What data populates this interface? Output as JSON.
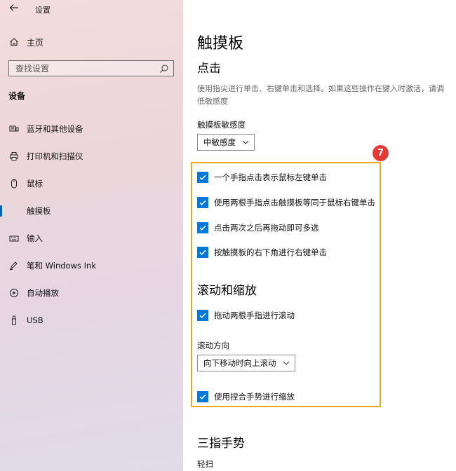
{
  "window": {
    "title": "设置",
    "back_label": "←"
  },
  "sidebar": {
    "home_label": "主页",
    "search_placeholder": "查找设置",
    "section_title": "设备",
    "items": [
      {
        "label": "蓝牙和其他设备",
        "icon": "bluetooth-devices-icon",
        "active": false
      },
      {
        "label": "打印机和扫描仪",
        "icon": "printer-icon",
        "active": false
      },
      {
        "label": "鼠标",
        "icon": "mouse-icon",
        "active": false
      },
      {
        "label": "触摸板",
        "icon": "touchpad-icon",
        "active": true
      },
      {
        "label": "输入",
        "icon": "keyboard-icon",
        "active": false
      },
      {
        "label": "笔和 Windows Ink",
        "icon": "pen-icon",
        "active": false
      },
      {
        "label": "自动播放",
        "icon": "autoplay-icon",
        "active": false
      },
      {
        "label": "USB",
        "icon": "usb-icon",
        "active": false
      }
    ]
  },
  "main": {
    "title": "触摸板",
    "tap": {
      "heading": "点击",
      "description": "使用指尖进行单击、右键单击和选择。如果这些操作在键入时激活，请调低敏感度",
      "sensitivity_label": "触摸板敏感度",
      "sensitivity_value": "中敏感度",
      "checkboxes": [
        {
          "label": "一个手指点击表示鼠标左键单击",
          "checked": true
        },
        {
          "label": "使用两根手指点击触摸板等同于鼠标右键单击",
          "checked": true
        },
        {
          "label": "点击两次之后再拖动即可多选",
          "checked": true
        },
        {
          "label": "按触摸板的右下角进行右键单击",
          "checked": true
        }
      ]
    },
    "scroll": {
      "heading": "滚动和缩放",
      "drag_scroll_label": "拖动两根手指进行滚动",
      "direction_label": "滚动方向",
      "direction_value": "向下移动时向上滚动",
      "pinch_label": "使用捏合手势进行缩放"
    },
    "three_finger": {
      "heading": "三指手势",
      "swipe_label": "轻扫"
    }
  },
  "annotation": {
    "badge": "7",
    "color": "#f0a616"
  },
  "colors": {
    "accent": "#0078d7",
    "badge_red": "#e53935"
  }
}
